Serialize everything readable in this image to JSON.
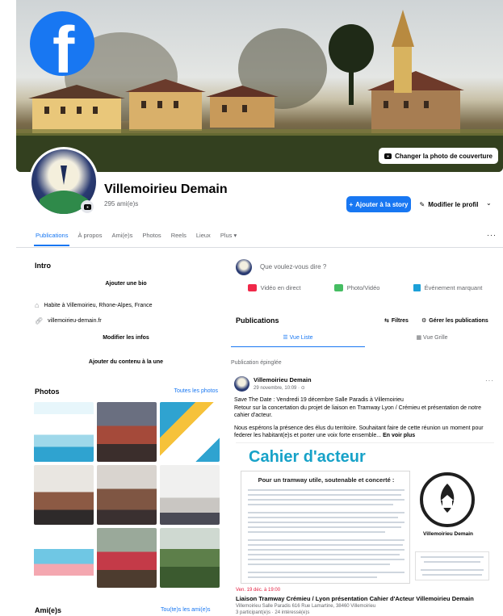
{
  "cover": {
    "change_cover_label": "Changer la photo de couverture"
  },
  "profile": {
    "name": "Villemoirieu Demain",
    "friends": "295 ami(e)s",
    "add_story_label": "Ajouter à la story",
    "edit_profile_label": "Modifier le profil"
  },
  "tabs": [
    {
      "label": "Publications",
      "active": true
    },
    {
      "label": "À propos"
    },
    {
      "label": "Ami(e)s"
    },
    {
      "label": "Photos"
    },
    {
      "label": "Reels"
    },
    {
      "label": "Lieux"
    },
    {
      "label": "Plus ▾"
    }
  ],
  "intro": {
    "title": "Intro",
    "add_bio": "Ajouter une bio",
    "lives_in": "Habite à Villemoirieu, Rhone-Alpes, France",
    "website": "villemoirieu-demain.fr",
    "edit_info": "Modifier les infos",
    "add_featured": "Ajouter du contenu à la une"
  },
  "photos": {
    "title": "Photos",
    "all_link": "Toutes les photos"
  },
  "friends_section": {
    "title": "Ami(e)s",
    "all_link": "Tou(te)s les ami(e)s"
  },
  "composer": {
    "placeholder": "Que voulez-vous dire ?",
    "actions": [
      "Vidéo en direct",
      "Photo/Vidéo",
      "Événement marquant"
    ]
  },
  "publications": {
    "title": "Publications",
    "filters_label": "Filtres",
    "manage_label": "Gérer les publications",
    "view_list": "Vue Liste",
    "view_grid": "Vue Grille"
  },
  "pinned_label": "Publication épinglée",
  "post": {
    "author": "Villemoirieu Demain",
    "date": "29 novembre, 10:09 · ⊙",
    "text_1": "Save The Date : Vendredi 19 décembre Salle Paradis à Villemoirieu",
    "text_2": "Retour sur la concertation du projet de liaison en Tramway Lyon / Crémieu et présentation de notre cahier d'acteur.",
    "text_3": "Nous espérons la présence des élus du territoire. Souhaitant faire de cette réunion un moment pour federer les habitant(e)s et porter une voix forte ensemble...",
    "see_more": "En voir plus",
    "doc_title": "Cahier d'acteur",
    "doc_subtitle": "Pour un tramway utile, soutenable et concerté :",
    "doc_logo_name": "Villemoirieu Demain",
    "event_date": "Ven. 19 déc. à 19:00",
    "event_title": "Liaison Tramway Crémieu / Lyon présentation Cahier d'Acteur Villemoirieu Demain",
    "event_location": "Villemoirieu Salle Paradis 616 Rue Lamartine, 38460 Villemoirieu",
    "event_participants": "3 participant(e)s · 24 intéressé(e)s"
  },
  "colors": {
    "accent": "#1877f2",
    "event_red": "#e41e3f",
    "doc_cyan": "#17a2c8"
  }
}
